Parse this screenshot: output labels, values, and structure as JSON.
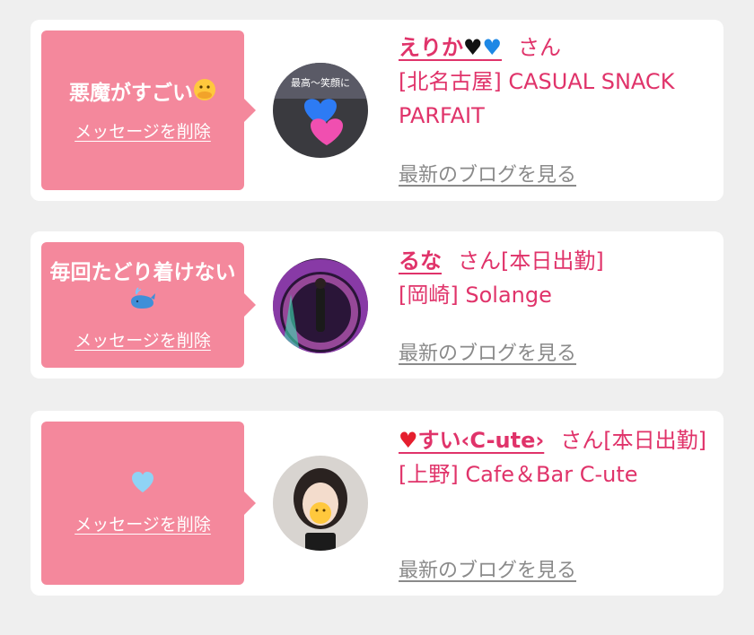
{
  "cards": [
    {
      "message": "悪魔がすごい",
      "message_emoji": "hand-over-mouth-face-emoji",
      "delete_label": "メッセージを削除",
      "name": "えりか",
      "name_suffix_icons": [
        "black-heart-icon",
        "blue-heart-icon"
      ],
      "san": "さん",
      "status": "",
      "shop": "[北名古屋] CASUAL SNACK PARFAIT",
      "blog_label": "最新のブログを見る",
      "avatar_text": "最高〜笑顔に"
    },
    {
      "message": "毎回たどり着けない",
      "message_emoji": "spouting-whale-emoji",
      "delete_label": "メッセージを削除",
      "name": "るな",
      "san": "さん",
      "status": "[本日出勤]",
      "shop": "[岡崎] Solange",
      "blog_label": "最新のブログを見る"
    },
    {
      "message": "",
      "message_emoji": "light-blue-heart-emoji",
      "delete_label": "メッセージを削除",
      "name": "すい‹C-ute›",
      "name_prefix_icon": "red-heart-icon",
      "san": "さん",
      "status": "[本日出勤]",
      "shop": "[上野] Cafe＆Bar C-ute",
      "blog_label": "最新のブログを見る"
    }
  ],
  "colors": {
    "background": "#efefef",
    "card": "#ffffff",
    "bubble": "#f4889c",
    "accent": "#e0336a",
    "muted_link": "#8a8a8a"
  }
}
